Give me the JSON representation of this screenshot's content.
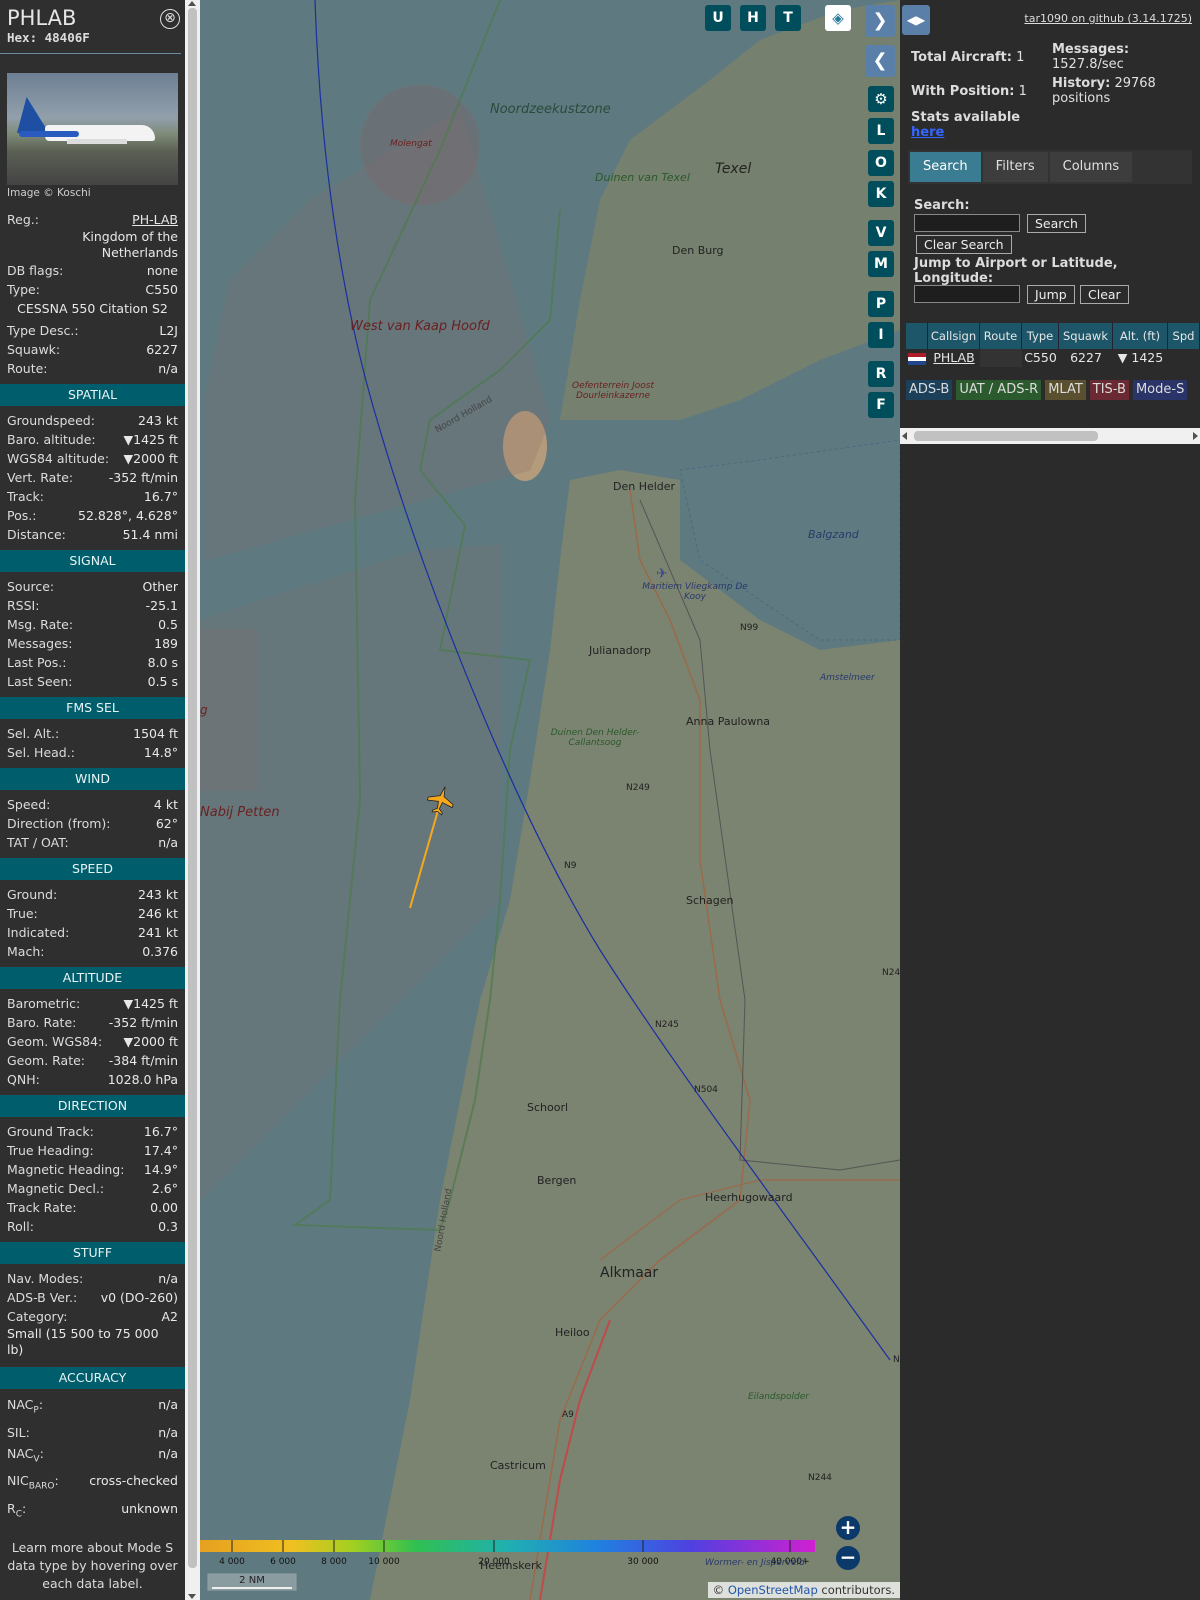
{
  "infobox": {
    "callsign": "PHLAB",
    "hex": "Hex: 48406F",
    "close_icon": "⊗",
    "image_credit": "Image © Koschi",
    "reg_label": "Reg.:",
    "reg_value": "PH-LAB",
    "country": "Kingdom of the Netherlands",
    "dbflags_label": "DB flags:",
    "dbflags_value": "none",
    "type_label": "Type:",
    "type_value": "C550",
    "type_full": "CESSNA 550 Citation S2",
    "typedesc_label": "Type Desc.:",
    "typedesc_value": "L2J",
    "squawk_label": "Squawk:",
    "squawk_value": "6227",
    "route_label": "Route:",
    "route_value": "n/a",
    "spatial_title": "SPATIAL",
    "spatial": [
      {
        "k": "Groundspeed:",
        "v": "243 kt"
      },
      {
        "k": "Baro. altitude:",
        "v": "▼1425 ft"
      },
      {
        "k": "WGS84 altitude:",
        "v": "▼2000 ft"
      },
      {
        "k": "Vert. Rate:",
        "v": "-352 ft/min"
      },
      {
        "k": "Track:",
        "v": "16.7°"
      },
      {
        "k": "Pos.:",
        "v": "52.828°, 4.628°"
      },
      {
        "k": "Distance:",
        "v": "51.4 nmi"
      }
    ],
    "signal_title": "SIGNAL",
    "signal": [
      {
        "k": "Source:",
        "v": "Other"
      },
      {
        "k": "RSSI:",
        "v": "-25.1"
      },
      {
        "k": "Msg. Rate:",
        "v": "0.5"
      },
      {
        "k": "Messages:",
        "v": "189"
      },
      {
        "k": "Last Pos.:",
        "v": "8.0 s"
      },
      {
        "k": "Last Seen:",
        "v": "0.5 s"
      }
    ],
    "fms_title": "FMS SEL",
    "fms": [
      {
        "k": "Sel. Alt.:",
        "v": "1504 ft"
      },
      {
        "k": "Sel. Head.:",
        "v": "14.8°"
      }
    ],
    "wind_title": "WIND",
    "wind": [
      {
        "k": "Speed:",
        "v": "4 kt"
      },
      {
        "k": "Direction (from):",
        "v": "62°"
      },
      {
        "k": "TAT / OAT:",
        "v": "n/a"
      }
    ],
    "speed_title": "SPEED",
    "speed": [
      {
        "k": "Ground:",
        "v": "243 kt"
      },
      {
        "k": "True:",
        "v": "246 kt"
      },
      {
        "k": "Indicated:",
        "v": "241 kt"
      },
      {
        "k": "Mach:",
        "v": "0.376"
      }
    ],
    "altitude_title": "ALTITUDE",
    "altitude": [
      {
        "k": "Barometric:",
        "v": "▼1425 ft"
      },
      {
        "k": "Baro. Rate:",
        "v": "-352 ft/min"
      },
      {
        "k": "Geom. WGS84:",
        "v": "▼2000 ft"
      },
      {
        "k": "Geom. Rate:",
        "v": "-384 ft/min"
      },
      {
        "k": "QNH:",
        "v": "1028.0 hPa"
      }
    ],
    "direction_title": "DIRECTION",
    "direction": [
      {
        "k": "Ground Track:",
        "v": "16.7°"
      },
      {
        "k": "True Heading:",
        "v": "17.4°"
      },
      {
        "k": "Magnetic Heading:",
        "v": "14.9°"
      },
      {
        "k": "Magnetic Decl.:",
        "v": "2.6°"
      },
      {
        "k": "Track Rate:",
        "v": "0.00"
      },
      {
        "k": "Roll:",
        "v": "0.3"
      }
    ],
    "stuff_title": "STUFF",
    "stuff": [
      {
        "k": "Nav. Modes:",
        "v": "n/a"
      },
      {
        "k": "ADS-B Ver.:",
        "v": "v0 (DO-260)"
      },
      {
        "k": "Category:",
        "v": "A2"
      }
    ],
    "category_desc": "Small (15 500 to 75 000 lb)",
    "accuracy_title": "ACCURACY",
    "accuracy": [
      {
        "k": "NAC",
        "sub": "P",
        "v": "n/a"
      },
      {
        "k": "SIL:",
        "sub": "",
        "v": "n/a"
      },
      {
        "k": "NAC",
        "sub": "V",
        "v": "n/a"
      },
      {
        "k": "NIC",
        "sub": "BARO",
        "v": "cross-checked"
      },
      {
        "k": "R",
        "sub": "C",
        "v": "unknown"
      }
    ],
    "learn_more": "Learn more about Mode S data type by hovering over each data label."
  },
  "map": {
    "labels": {
      "noordzee": "Noordzeekustzone",
      "texel": "Texel",
      "duinen_texel": "Duinen van Texel",
      "den_burg": "Den Burg",
      "molengat": "Molengat",
      "west_van_kaap": "West van Kaap Hoofd",
      "oefenterrein": "Oefenterrein Joost Dourleinkazerne",
      "noord_holland": "Noord Holland",
      "den_helder": "Den Helder",
      "balgzand": "Balgzand",
      "maritiem": "Maritiem Vliegkamp De Kooy",
      "n99": "N99",
      "julianadorp": "Julianadorp",
      "amstelmeer": "Amstelmeer",
      "anna_paulowna": "Anna Paulowna",
      "duinen_dh": "Duinen Den Helder-Callantsoog",
      "n249": "N249",
      "nabij_petten": "Nabij Petten",
      "g": "g",
      "n9": "N9",
      "schagen": "Schagen",
      "n24": "N24",
      "n245": "N245",
      "n504": "N504",
      "schoorl": "Schoorl",
      "bergen": "Bergen",
      "heerhugowaard": "Heerhugowaard",
      "noord_holland2": "Noord Holland",
      "alkmaar": "Alkmaar",
      "heiloo": "Heiloo",
      "n_edge": "N",
      "eilandspolder": "Eilandspolder",
      "a9": "A9",
      "castricum": "Castricum",
      "n244": "N244",
      "heemskerk": "Heemskerk",
      "wormer": "Wormer- en Jisperveld"
    },
    "buttons": {
      "u": "U",
      "h": "H",
      "t": "T",
      "l": "L",
      "o": "O",
      "k": "K",
      "v": "V",
      "m": "M",
      "p": "P",
      "i": "I",
      "r": "R",
      "f": "F"
    },
    "altitude_scale": [
      "4 000",
      "6 000",
      "8 000",
      "10 000",
      "20 000",
      "30 000",
      "40 000+"
    ],
    "scale_bar": "2 NM",
    "attribution_prefix": "© ",
    "attribution_link": "OpenStreetMap",
    "attribution_suffix": " contributors.",
    "colors": {
      "aircraft": "#f7a81b",
      "track": "#1a2fa0",
      "water": "#5e7a80",
      "land": "#7b8371"
    }
  },
  "panel": {
    "github": "tar1090 on github (3.14.1725)",
    "total_label": "Total Aircraft:",
    "total_value": "1",
    "withpos_label": "With Position:",
    "withpos_value": "1",
    "messages_label": "Messages:",
    "messages_value": "1527.8/sec",
    "history_label": "History:",
    "history_value": "29768 positions",
    "stats_text": "Stats available",
    "stats_link": "here",
    "tabs": [
      "Search",
      "Filters",
      "Columns"
    ],
    "search_label": "Search:",
    "search_button": "Search",
    "clear_search_button": "Clear Search",
    "jump_label": "Jump to Airport or Latitude, Longitude:",
    "jump_button": "Jump",
    "clear_button": "Clear",
    "columns": [
      "Callsign",
      "Route",
      "Type",
      "Squawk",
      "Alt. (ft)",
      "Spd"
    ],
    "row": {
      "callsign": "PHLAB",
      "route": "",
      "type": "C550",
      "squawk": "6227",
      "alt": "▼ 1425"
    },
    "legend": [
      {
        "label": "ADS-B",
        "color": "#1c3f5a"
      },
      {
        "label": "UAT / ADS-R",
        "color": "#2b5a2e"
      },
      {
        "label": "MLAT",
        "color": "#5a5030"
      },
      {
        "label": "TIS-B",
        "color": "#6b2a33"
      },
      {
        "label": "Mode-S",
        "color": "#2a3468"
      }
    ]
  }
}
